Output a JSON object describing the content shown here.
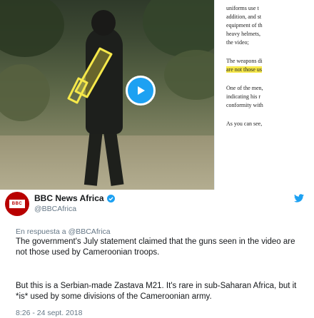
{
  "media": {
    "article_lines": [
      "uniforms use t\naddition, and st\nequipment of th\nheavy helmets,\nthe video;",
      "The weapons di",
      "One of the men,\nindicating his r\nconformity with",
      "As you can see,"
    ],
    "article_highlight": "are not those us",
    "play_label": "Play video"
  },
  "tweet": {
    "avatar_text": "BBC\nNEWS",
    "display_name": "BBC News Africa",
    "handle": "@BBCAfrica",
    "reply_prefix": "En respuesta a",
    "reply_mention": "@BBCAfrica",
    "text_1": "The government's July statement claimed that the guns seen in the video are not those used by Cameroonian troops.",
    "text_2": "But this is a Serbian-made Zastava M21. It's rare in sub-Saharan Africa, but it *is* used by some divisions of the Cameroonian army.",
    "timestamp": "8:26 - 24 sept. 2018"
  },
  "colors": {
    "twitter_blue": "#1da1f2",
    "bbc_red": "#b80000",
    "highlight_yellow": "#f6e84a",
    "muted": "#657786"
  },
  "icons": [
    "play-icon",
    "verified-badge-icon",
    "twitter-bird-icon"
  ]
}
